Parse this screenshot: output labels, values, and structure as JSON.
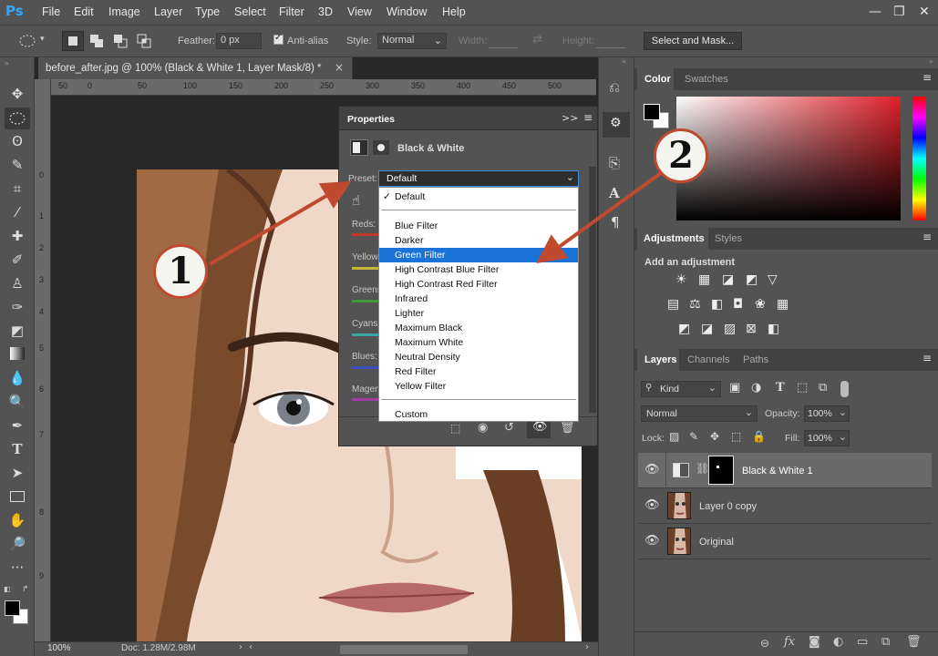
{
  "app": {
    "logo": "Ps"
  },
  "menu": [
    "File",
    "Edit",
    "Image",
    "Layer",
    "Type",
    "Select",
    "Filter",
    "3D",
    "View",
    "Window",
    "Help"
  ],
  "options": {
    "feather_label": "Feather:",
    "feather_value": "0 px",
    "antialias_label": "Anti-alias",
    "style_label": "Style:",
    "style_value": "Normal",
    "width_label": "Width:",
    "height_label": "Height:",
    "select_mask_button": "Select and Mask..."
  },
  "document": {
    "tab_title": "before_after.jpg @ 100% (Black & White 1, Layer Mask/8) *",
    "close": "×",
    "ruler_top": [
      "50",
      "0",
      "50",
      "100",
      "150",
      "200",
      "250",
      "300",
      "350",
      "400",
      "450",
      "500",
      "550"
    ],
    "ruler_left": [
      "0",
      "1",
      "2",
      "3",
      "4",
      "5",
      "6",
      "7",
      "8",
      "9"
    ],
    "zoom": "100%",
    "doc_info": "Doc: 1.28M/2.98M"
  },
  "properties": {
    "title": "Properties",
    "adjustment_name": "Black & White",
    "preset_label": "Preset:",
    "preset_value": "Default",
    "sliders": [
      "Reds:",
      "Yellows:",
      "Greens:",
      "Cyans:",
      "Blues:",
      "Magen"
    ],
    "slider_colors": [
      "#c0392b",
      "#c9b43a",
      "#3c9a3c",
      "#39a6a6",
      "#3a4fc0",
      "#a43aa8"
    ]
  },
  "preset_dropdown": {
    "items": [
      "Default",
      "Blue Filter",
      "Darker",
      "Green Filter",
      "High Contrast Blue Filter",
      "High Contrast Red Filter",
      "Infrared",
      "Lighter",
      "Maximum Black",
      "Maximum White",
      "Neutral Density",
      "Red Filter",
      "Yellow Filter",
      "Custom"
    ],
    "checked": "Default",
    "selected": "Green Filter",
    "check_mark": "✓"
  },
  "callouts": {
    "one": "1",
    "two": "2"
  },
  "color_panel": {
    "tabs": [
      "Color",
      "Swatches"
    ],
    "active_tab": "Color",
    "foreground": "#000000",
    "background": "#ffffff",
    "hue_color": "#e0202a"
  },
  "adjustments_panel": {
    "tabs": [
      "Adjustments",
      "Styles"
    ],
    "active_tab": "Adjustments",
    "hint": "Add an adjustment"
  },
  "layers_panel": {
    "tabs": [
      "Layers",
      "Channels",
      "Paths"
    ],
    "active_tab": "Layers",
    "filter_kind": "Kind",
    "blend_mode": "Normal",
    "opacity_label": "Opacity:",
    "opacity_value": "100%",
    "lock_label": "Lock:",
    "fill_label": "Fill:",
    "fill_value": "100%",
    "layers": [
      {
        "name": "Black & White 1",
        "type": "adjustment"
      },
      {
        "name": "Layer 0 copy",
        "type": "image"
      },
      {
        "name": "Original",
        "type": "image"
      }
    ]
  }
}
